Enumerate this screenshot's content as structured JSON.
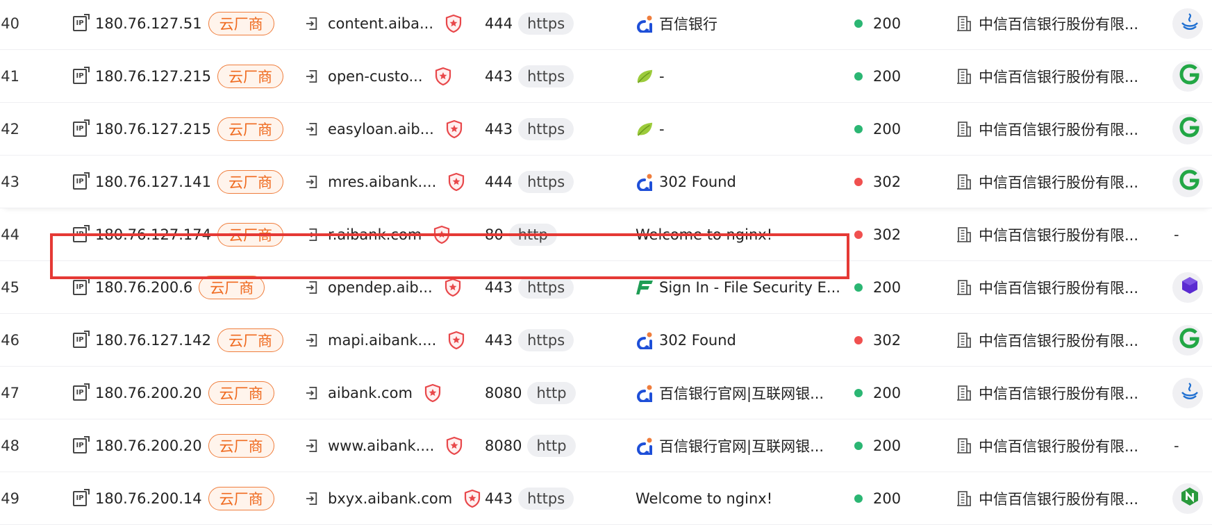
{
  "colors": {
    "accent_orange": "#ef6a1f",
    "status_green": "#2bb673",
    "status_red": "#f0504f",
    "highlight_red": "#e53935"
  },
  "rows": [
    {
      "num": "40",
      "ip": "180.76.127.51",
      "tag": "云厂商",
      "domain": "content.aiba...",
      "port": "444",
      "proto": "https",
      "favicon": "aibank-icon",
      "title": "百信银行",
      "status_color": "green",
      "status": "200",
      "org": "中信百信银行股份有限...",
      "extra": "java-icon"
    },
    {
      "num": "41",
      "ip": "180.76.127.215",
      "tag": "云厂商",
      "domain": "open-custo...",
      "port": "443",
      "proto": "https",
      "favicon": "spring-leaf-icon",
      "title": "-",
      "status_color": "green",
      "status": "200",
      "org": "中信百信银行股份有限...",
      "extra": "green-g-icon"
    },
    {
      "num": "42",
      "ip": "180.76.127.215",
      "tag": "云厂商",
      "domain": "easyloan.aib...",
      "port": "443",
      "proto": "https",
      "favicon": "spring-leaf-icon",
      "title": "-",
      "status_color": "green",
      "status": "200",
      "org": "中信百信银行股份有限...",
      "extra": "green-g-icon"
    },
    {
      "num": "43",
      "ip": "180.76.127.141",
      "tag": "云厂商",
      "domain": "mres.aibank....",
      "port": "444",
      "proto": "https",
      "favicon": "aibank-icon",
      "title": "302 Found",
      "status_color": "red",
      "status": "302",
      "org": "中信百信银行股份有限...",
      "extra": "green-g-icon"
    },
    {
      "num": "44",
      "ip": "180.76.127.174",
      "tag": "云厂商",
      "domain": "r.aibank.com",
      "port": "80",
      "proto": "http",
      "favicon": "",
      "title": "Welcome to nginx!",
      "status_color": "red",
      "status": "302",
      "org": "中信百信银行股份有限...",
      "extra": "-"
    },
    {
      "num": "45",
      "ip": "180.76.200.6",
      "tag": "云厂商",
      "domain": "opendep.aib...",
      "port": "443",
      "proto": "https",
      "favicon": "file-security-icon",
      "title": "Sign In - File Security E...",
      "status_color": "green",
      "status": "200",
      "org": "中信百信银行股份有限...",
      "extra": "purple-cube-icon"
    },
    {
      "num": "46",
      "ip": "180.76.127.142",
      "tag": "云厂商",
      "domain": "mapi.aibank....",
      "port": "443",
      "proto": "https",
      "favicon": "aibank-icon",
      "title": "302 Found",
      "status_color": "red",
      "status": "302",
      "org": "中信百信银行股份有限...",
      "extra": "green-g-icon"
    },
    {
      "num": "47",
      "ip": "180.76.200.20",
      "tag": "云厂商",
      "domain": "aibank.com",
      "port": "8080",
      "proto": "http",
      "favicon": "aibank-icon",
      "title": "百信银行官网|互联网银...",
      "status_color": "green",
      "status": "200",
      "org": "中信百信银行股份有限...",
      "extra": "java-icon"
    },
    {
      "num": "48",
      "ip": "180.76.200.20",
      "tag": "云厂商",
      "domain": "www.aibank....",
      "port": "8080",
      "proto": "http",
      "favicon": "aibank-icon",
      "title": "百信银行官网|互联网银...",
      "status_color": "green",
      "status": "200",
      "org": "中信百信银行股份有限...",
      "extra": "-"
    },
    {
      "num": "49",
      "ip": "180.76.200.14",
      "tag": "云厂商",
      "domain": "bxyx.aibank.com",
      "port": "443",
      "proto": "https",
      "favicon": "",
      "title": "Welcome to nginx!",
      "status_color": "green",
      "status": "200",
      "org": "中信百信银行股份有限...",
      "extra": "nginx-n-icon"
    }
  ]
}
